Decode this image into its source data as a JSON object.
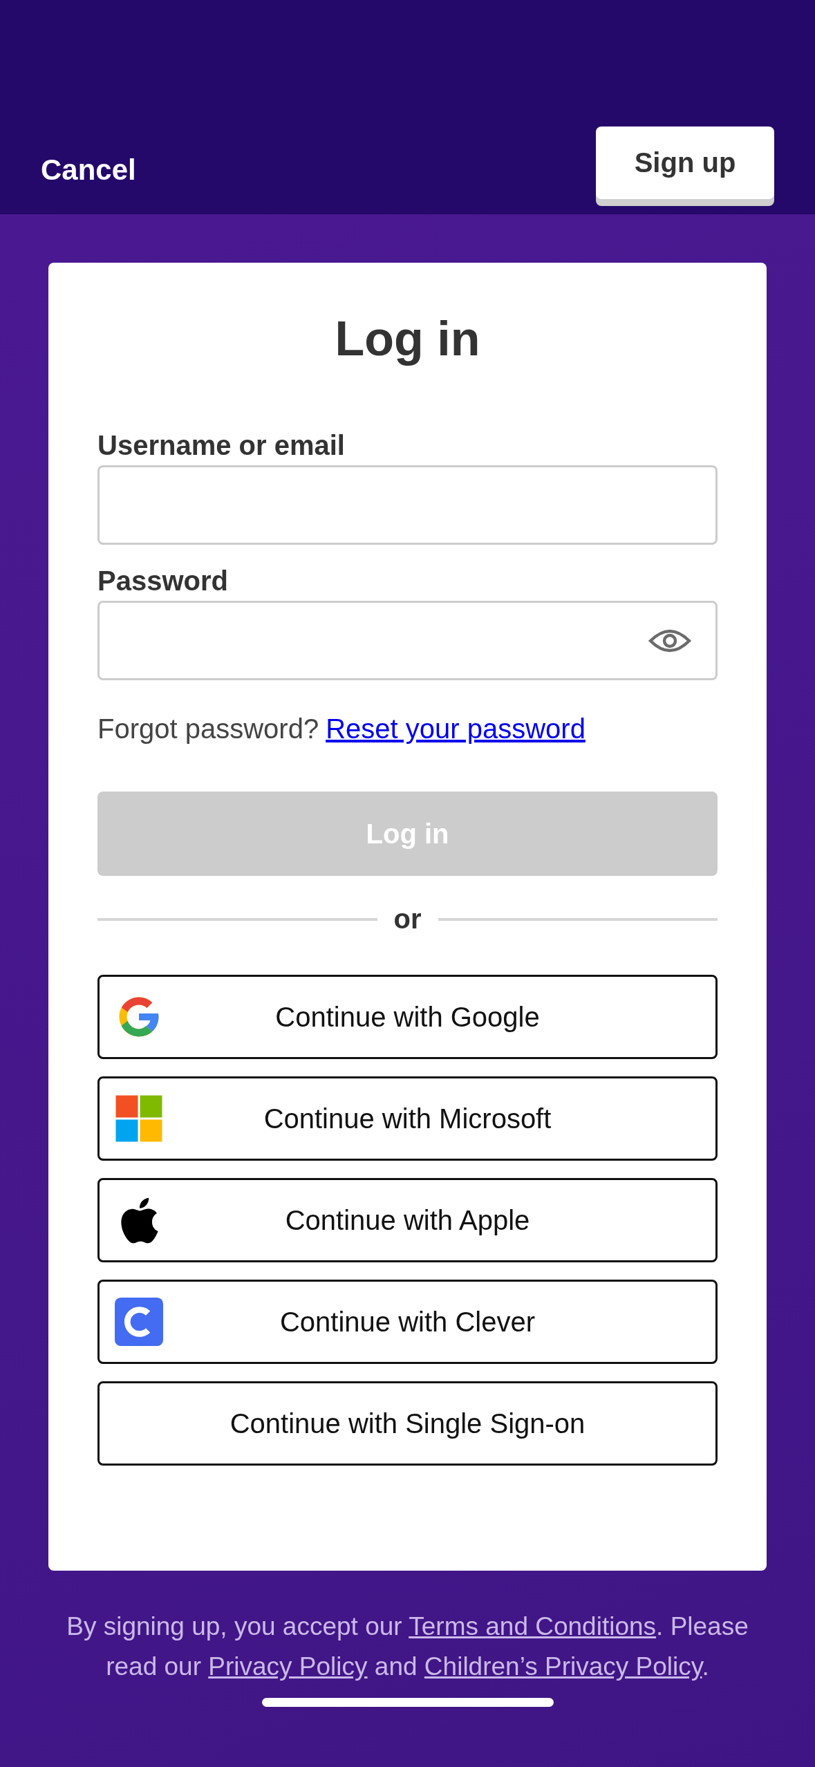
{
  "header": {
    "cancel": "Cancel",
    "sign_up": "Sign up"
  },
  "card": {
    "title": "Log in",
    "fields": [
      {
        "label": "Username or email",
        "kind": "text"
      },
      {
        "label": "Password",
        "kind": "password"
      }
    ],
    "forgot": {
      "text": "Forgot password?",
      "link": "Reset your password"
    },
    "login_button": {
      "label": "Log in",
      "disabled": true
    },
    "divider": "or",
    "providers": [
      {
        "label": "Continue with Google",
        "kind": "google"
      },
      {
        "label": "Continue with Microsoft",
        "kind": "microsoft"
      },
      {
        "label": "Continue with Apple",
        "kind": "apple"
      },
      {
        "label": "Continue with Clever",
        "kind": "clever"
      },
      {
        "label": "Continue with Single Sign-on",
        "kind": "none"
      }
    ]
  },
  "footer": [
    {
      "text": "By signing up, you accept our ",
      "link": false
    },
    {
      "text": "Terms and Conditions",
      "link": true
    },
    {
      "text": ". Please read our ",
      "link": false
    },
    {
      "text": "Privacy Policy",
      "link": true
    },
    {
      "text": " and ",
      "link": false
    },
    {
      "text": "Children’s Privacy Policy",
      "link": true
    },
    {
      "text": ".",
      "link": false
    }
  ]
}
